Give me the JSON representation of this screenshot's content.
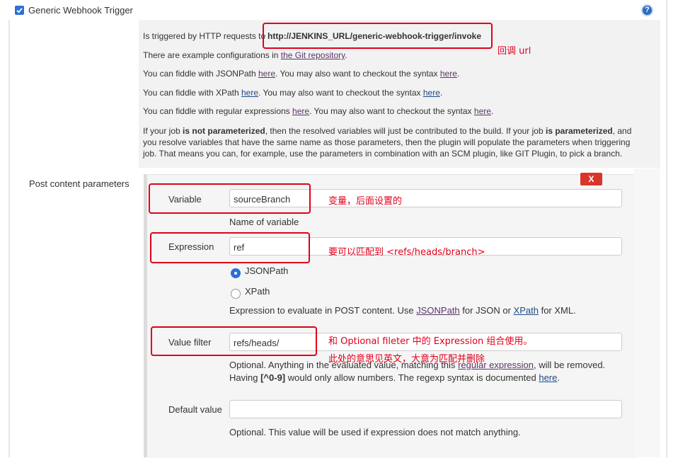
{
  "header": {
    "checkbox_label": "Generic Webhook Trigger"
  },
  "info": {
    "line1_pre": "Is triggered by HTTP requests to",
    "line1_url": "http://JENKINS_URL/generic-webhook-trigger/invoke",
    "line2_pre": "There are example configurations in",
    "line2_link": "the Git repository",
    "line3_pre": "You can fiddle with JSONPath",
    "line3_mid": ". You may also want to checkout the syntax",
    "line4_pre": "You can fiddle with XPath",
    "line4_mid": ". You may also want to checkout the syntax",
    "line5_pre": "You can fiddle with regular expressions",
    "line5_mid": ". You may also want to checkout the syntax",
    "here": "here",
    "para_a": "If your job",
    "para_b": "is not parameterized",
    "para_c": ", then the resolved variables will just be contributed to the build. If your job",
    "para_d": "is parameterized",
    "para_e": ", and you resolve variables that have the same name as those parameters, then the plugin will populate the parameters when triggering job. That means you can, for example, use the parameters in combination with an SCM plugin, like GIT Plugin, to pick a branch."
  },
  "post_params": {
    "section_label": "Post content parameters",
    "delete_label": "X",
    "variable": {
      "label": "Variable",
      "value": "sourceBranch",
      "help": "Name of variable"
    },
    "expression": {
      "label": "Expression",
      "value": "ref",
      "options": [
        "JSONPath",
        "XPath"
      ],
      "selected": "JSONPath",
      "help_pre": "Expression to evaluate in POST content. Use",
      "help_link1": "JSONPath",
      "help_mid": "for JSON or",
      "help_link2": "XPath",
      "help_post": "for XML."
    },
    "value_filter": {
      "label": "Value filter",
      "value": "refs/heads/",
      "help_a": "Optional. Anything in the evaluated value, matching this",
      "help_link": "regular expression",
      "help_b": ", will be removed.",
      "help_c": "Having",
      "help_code": "[^0-9]",
      "help_d": "would only allow numbers. The regexp syntax is documented",
      "help_link2": "here"
    },
    "default_value": {
      "label": "Default value",
      "value": "",
      "help": "Optional. This value will be used if expression does not match anything."
    }
  },
  "annotations": {
    "callback": "回调 url",
    "variable_note": "变量，后面设置的",
    "expression_note": "要可以匹配到 <refs/heads/branch>",
    "filter_note1": "和 Optional fileter 中的 Expression 组合使用。",
    "filter_note2": "此处的意思见英文，大意为匹配并删除"
  },
  "colors": {
    "annotation_red": "#e0001a",
    "delete_button": "#d9362a",
    "help_icon": "#2a6ebb"
  }
}
